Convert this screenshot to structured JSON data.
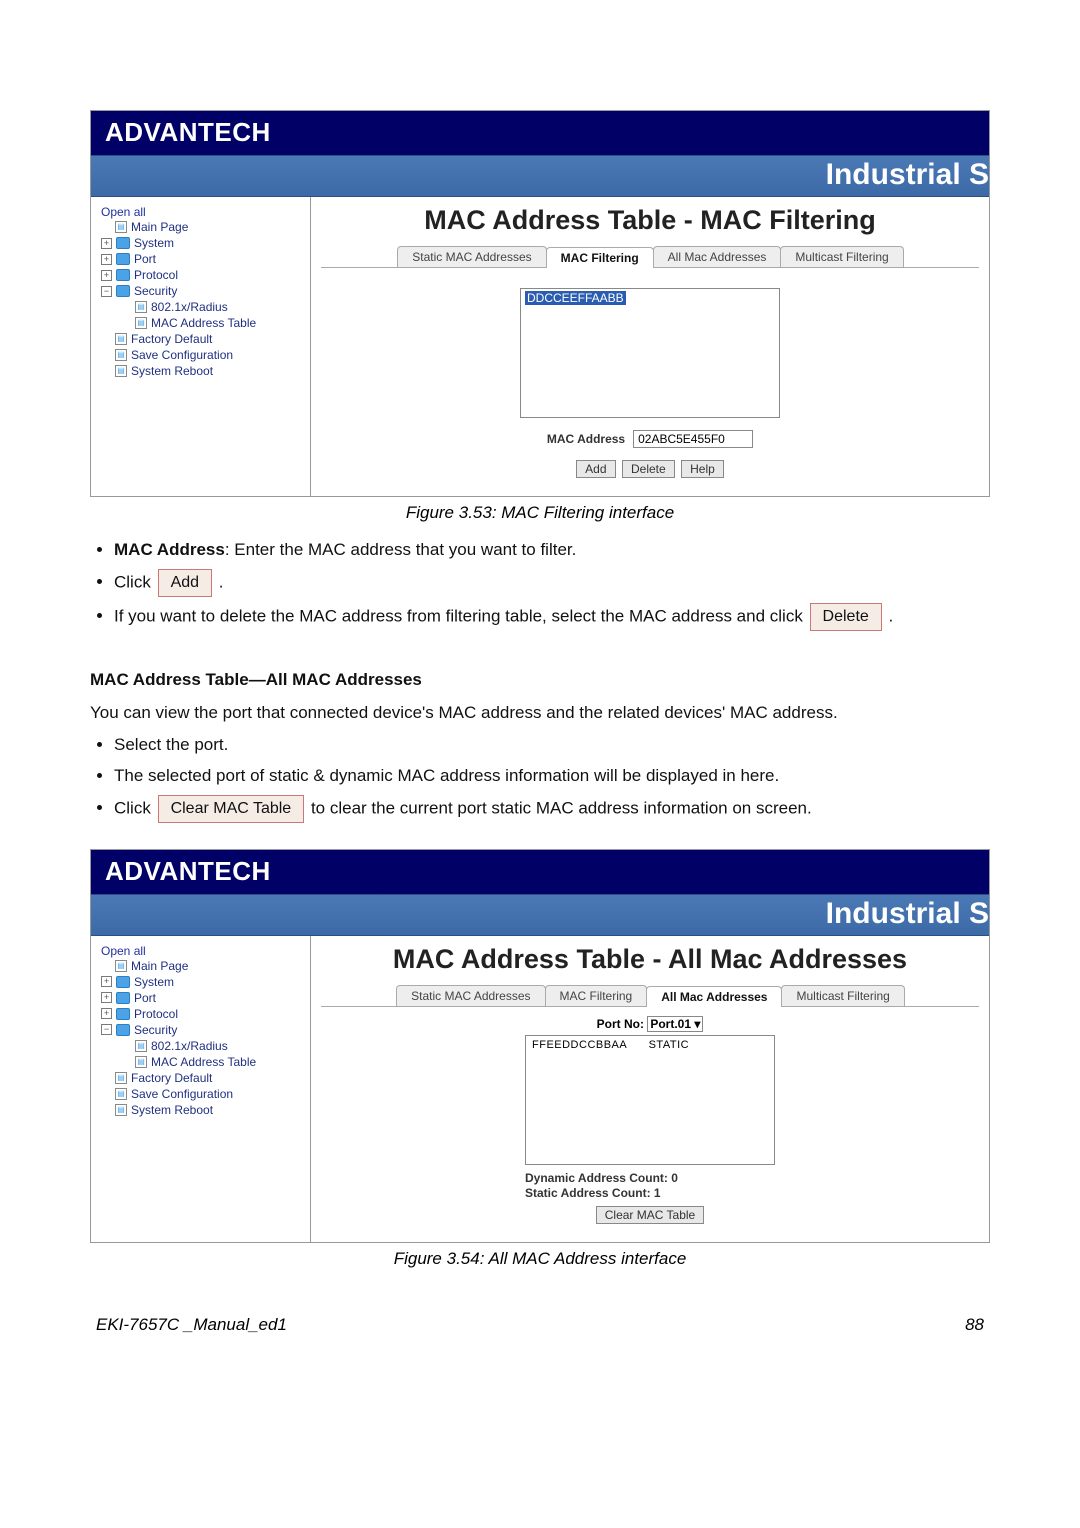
{
  "brand": "ADVANTECH",
  "header_banner": "Industrial S",
  "nav": {
    "open_all": "Open all",
    "items": [
      "Main Page",
      "System",
      "Port",
      "Protocol",
      "Security",
      "802.1x/Radius",
      "MAC Address Table",
      "Factory Default",
      "Save Configuration",
      "System Reboot"
    ]
  },
  "tabs_static": "Static MAC Addresses",
  "tabs_filter": "MAC Filtering",
  "tabs_all": "All Mac Addresses",
  "tabs_multi": "Multicast Filtering",
  "fig1": {
    "title": "MAC Address Table - MAC Filtering",
    "list_value": "DDCCEEFFAABB",
    "field_label": "MAC Address",
    "field_value": "02ABC5E455F0",
    "btn_add": "Add",
    "btn_delete": "Delete",
    "btn_help": "Help",
    "caption": "Figure 3.53: MAC Filtering interface"
  },
  "doc1": {
    "li1_bold": "MAC Address",
    "li1_rest": ": Enter the MAC address that you want to filter.",
    "li2_pre": "Click ",
    "li2_btn": "Add",
    "li2_post": " .",
    "li3_pre": "If you want to delete the MAC address from filtering table, select the MAC address and click ",
    "li3_btn": "Delete",
    "li3_post": " ."
  },
  "subhead": "MAC Address Table—All MAC Addresses",
  "para_all": "You can view the port that connected device's MAC address and the related devices' MAC address.",
  "doc2": {
    "li1": "Select the port.",
    "li2": "The selected port of static & dynamic MAC address information will be displayed in here.",
    "li3_pre": "Click ",
    "li3_btn": "Clear MAC Table",
    "li3_post": " to clear the current port static MAC address information on screen."
  },
  "fig2": {
    "title": "MAC Address Table - All Mac Addresses",
    "port_label": "Port No:",
    "port_value": "Port.01",
    "row_mac": "FFEEDDCCBBAA",
    "row_type": "STATIC",
    "dyn_label": "Dynamic Address Count:",
    "dyn_val": "0",
    "stat_label": "Static Address Count:",
    "stat_val": "1",
    "btn_clear": "Clear MAC Table",
    "caption": "Figure 3.54: All MAC Address interface"
  },
  "footer": {
    "left": "EKI-7657C _Manual_ed1",
    "right": "88"
  }
}
